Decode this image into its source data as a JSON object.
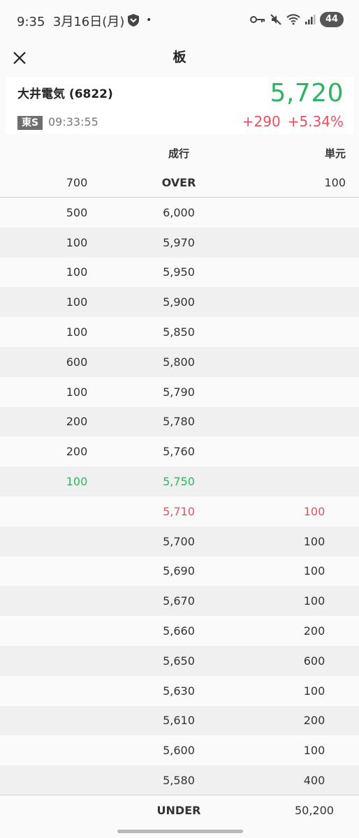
{
  "status_bar": {
    "time": "9:35",
    "date": "3月16日(月)",
    "dot": "•",
    "battery": "44"
  },
  "app_bar": {
    "title": "板"
  },
  "stock": {
    "name": "大井電気 (6822)",
    "price": "5,720",
    "market": "東S",
    "time": "09:33:55",
    "change": "+290",
    "change_pct": "+5.34%",
    "price_color": "#2fb562",
    "change_color": "#e9505e"
  },
  "board_header": {
    "market_order": "成行",
    "unit": "単元"
  },
  "over": {
    "sell_qty": "700",
    "label": "OVER",
    "unit_value": "100"
  },
  "sell_rows": [
    {
      "qty": "500",
      "price": "6,000"
    },
    {
      "qty": "100",
      "price": "5,970"
    },
    {
      "qty": "100",
      "price": "5,950"
    },
    {
      "qty": "100",
      "price": "5,900"
    },
    {
      "qty": "100",
      "price": "5,850"
    },
    {
      "qty": "600",
      "price": "5,800"
    },
    {
      "qty": "100",
      "price": "5,790"
    },
    {
      "qty": "200",
      "price": "5,780"
    },
    {
      "qty": "200",
      "price": "5,760"
    },
    {
      "qty": "100",
      "price": "5,750"
    }
  ],
  "buy_rows": [
    {
      "price": "5,710",
      "qty": "100"
    },
    {
      "price": "5,700",
      "qty": "100"
    },
    {
      "price": "5,690",
      "qty": "100"
    },
    {
      "price": "5,670",
      "qty": "100"
    },
    {
      "price": "5,660",
      "qty": "200"
    },
    {
      "price": "5,650",
      "qty": "600"
    },
    {
      "price": "5,630",
      "qty": "100"
    },
    {
      "price": "5,610",
      "qty": "200"
    },
    {
      "price": "5,600",
      "qty": "100"
    },
    {
      "price": "5,580",
      "qty": "400"
    }
  ],
  "under": {
    "label": "UNDER",
    "buy_qty": "50,200"
  },
  "icons": {
    "close": "close-icon",
    "shield": "shield-icon",
    "key": "vpn-key-icon",
    "mute": "mute-icon",
    "wifi": "wifi-icon",
    "signal": "signal-icon"
  },
  "colors": {
    "best_ask": "#2fb562",
    "best_bid": "#e9505e"
  }
}
